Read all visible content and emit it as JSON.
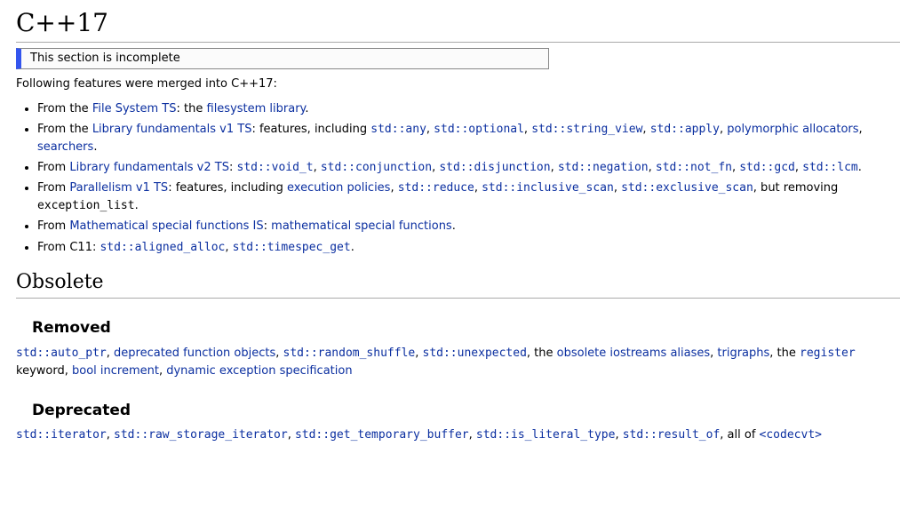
{
  "page": {
    "title": "C++17",
    "notice": "This section is incomplete",
    "intro": "Following features were merged into C++17:"
  },
  "bullets": [
    {
      "prefix": "From the ",
      "source": "File System TS",
      "mid1": ": the ",
      "links": [
        {
          "text": "filesystem library",
          "code": false
        }
      ],
      "tail": "."
    },
    {
      "prefix": "From the ",
      "source": "Library fundamentals v1 TS",
      "mid1": ": features, including ",
      "links": [
        {
          "text": "std::any",
          "code": true
        },
        {
          "sep": ", "
        },
        {
          "text": "std::optional",
          "code": true
        },
        {
          "sep": ", "
        },
        {
          "text": "std::string_view",
          "code": true
        },
        {
          "sep": ", "
        },
        {
          "text": "std::apply",
          "code": true
        },
        {
          "sep": ", "
        },
        {
          "text": "polymorphic allocators",
          "code": false
        },
        {
          "sep": ", "
        },
        {
          "text": "searchers",
          "code": false
        }
      ],
      "tail": "."
    },
    {
      "prefix": "From ",
      "source": "Library fundamentals v2 TS",
      "mid1": ": ",
      "links": [
        {
          "text": "std::void_t",
          "code": true
        },
        {
          "sep": ", "
        },
        {
          "text": "std::conjunction",
          "code": true
        },
        {
          "sep": ", "
        },
        {
          "text": "std::disjunction",
          "code": true
        },
        {
          "sep": ", "
        },
        {
          "text": "std::negation",
          "code": true
        },
        {
          "sep": ", "
        },
        {
          "text": "std::not_fn",
          "code": true
        },
        {
          "sep": ", "
        },
        {
          "text": "std::gcd",
          "code": true
        },
        {
          "sep": ", "
        },
        {
          "text": "std::lcm",
          "code": true
        }
      ],
      "tail": "."
    },
    {
      "prefix": "From ",
      "source": "Parallelism v1 TS",
      "mid1": ": features, including ",
      "links": [
        {
          "text": "execution policies",
          "code": false
        },
        {
          "sep": ", "
        },
        {
          "text": "std::reduce",
          "code": true
        },
        {
          "sep": ", "
        },
        {
          "text": "std::inclusive_scan",
          "code": true
        },
        {
          "sep": ", "
        },
        {
          "text": "std::exclusive_scan",
          "code": true
        }
      ],
      "tail_parts": [
        {
          "text": ", but removing ",
          "plain": true
        },
        {
          "text": "exception_list",
          "codeplain": true
        },
        {
          "text": ".",
          "plain": true
        }
      ]
    },
    {
      "prefix": "From ",
      "source": "Mathematical special functions IS",
      "mid1": ": ",
      "links": [
        {
          "text": "mathematical special functions",
          "code": false
        }
      ],
      "tail": "."
    },
    {
      "prefix": "From C11: ",
      "source": null,
      "mid1": "",
      "links": [
        {
          "text": "std::aligned_alloc",
          "code": true
        },
        {
          "sep": ", "
        },
        {
          "text": "std::timespec_get",
          "code": true
        }
      ],
      "tail": "."
    }
  ],
  "obsolete": {
    "heading": "Obsolete",
    "removed": {
      "heading": "Removed",
      "parts": [
        {
          "text": "std::auto_ptr",
          "code": true,
          "link": true
        },
        {
          "sep": ", "
        },
        {
          "text": "deprecated function objects",
          "link": true
        },
        {
          "sep": ", "
        },
        {
          "text": "std::random_shuffle",
          "code": true,
          "link": true
        },
        {
          "sep": ", "
        },
        {
          "text": "std::unexpected",
          "code": true,
          "link": true
        },
        {
          "sep": ", the "
        },
        {
          "text": "obsolete iostreams aliases",
          "link": true
        },
        {
          "sep": ", "
        },
        {
          "text": "trigraphs",
          "link": true
        },
        {
          "sep": ", the "
        },
        {
          "text": "register",
          "code": true,
          "link": true
        },
        {
          "sep": " keyword, "
        },
        {
          "text": "bool increment",
          "link": true
        },
        {
          "sep": ", "
        },
        {
          "text": "dynamic exception specification",
          "link": true
        }
      ]
    },
    "deprecated": {
      "heading": "Deprecated",
      "parts": [
        {
          "text": "std::iterator",
          "code": true,
          "link": true
        },
        {
          "sep": ", "
        },
        {
          "text": "std::raw_storage_iterator",
          "code": true,
          "link": true
        },
        {
          "sep": ", "
        },
        {
          "text": "std::get_temporary_buffer",
          "code": true,
          "link": true
        },
        {
          "sep": ", "
        },
        {
          "text": "std::is_literal_type",
          "code": true,
          "link": true
        },
        {
          "sep": ", "
        },
        {
          "text": "std::result_of",
          "code": true,
          "link": true
        },
        {
          "sep": ", all of "
        },
        {
          "text": "<codecvt>",
          "code": true,
          "link": true
        }
      ]
    }
  }
}
